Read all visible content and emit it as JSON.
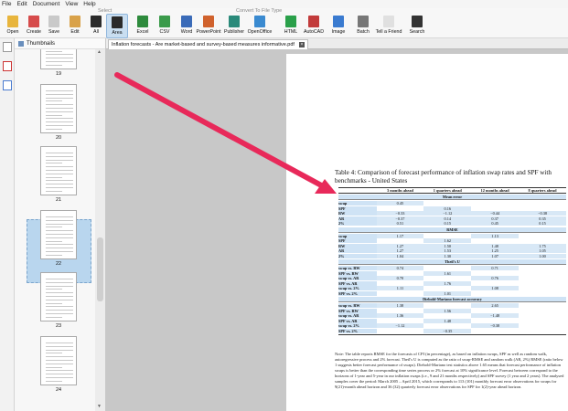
{
  "menu": [
    "File",
    "Edit",
    "Document",
    "View",
    "Help"
  ],
  "toolbar": {
    "select_group": "Select",
    "convert_group": "Convert To File Type",
    "tools": [
      {
        "label": "Open",
        "icon": "folder-icon",
        "color": "#e8b53d"
      },
      {
        "label": "Create",
        "icon": "create-pdf-icon",
        "color": "#d64b4b"
      },
      {
        "label": "Save",
        "icon": "save-icon",
        "color": "#c9c9c9"
      },
      {
        "label": "Edit",
        "icon": "edit-icon",
        "color": "#d9a24a"
      },
      {
        "label": "All",
        "icon": "select-all-icon",
        "color": "#2b2b2b"
      },
      {
        "label": "Area",
        "icon": "select-area-icon",
        "color": "#2b2b2b"
      },
      {
        "label": "Excel",
        "icon": "excel-icon",
        "color": "#2e8b3d"
      },
      {
        "label": "CSV",
        "icon": "csv-icon",
        "color": "#3b9b4b"
      },
      {
        "label": "Word",
        "icon": "word-icon",
        "color": "#3a6bb8"
      },
      {
        "label": "PowerPoint",
        "icon": "powerpoint-icon",
        "color": "#d0622d"
      },
      {
        "label": "Publisher",
        "icon": "publisher-icon",
        "color": "#2a8a7a"
      },
      {
        "label": "OpenOffice",
        "icon": "openoffice-icon",
        "color": "#3a8ad0"
      },
      {
        "label": "HTML",
        "icon": "html-icon",
        "color": "#2aa04a"
      },
      {
        "label": "AutoCAD",
        "icon": "autocad-icon",
        "color": "#c23b3b"
      },
      {
        "label": "Image",
        "icon": "image-icon",
        "color": "#3a7bd0"
      },
      {
        "label": "Batch",
        "icon": "batch-icon",
        "color": "#777777"
      },
      {
        "label": "Tell a Friend",
        "icon": "mail-icon",
        "color": "#e0e0e0"
      },
      {
        "label": "Search",
        "icon": "binoculars-icon",
        "color": "#333333"
      }
    ]
  },
  "thumbnails": {
    "title": "Thumbnails",
    "pages": [
      "19",
      "20",
      "21",
      "22",
      "23",
      "24"
    ],
    "selected": "22"
  },
  "document": {
    "tab_title": "Inflation forecasts - Are market-based and survey-based measures informative.pdf",
    "table_caption": "Table 4: Comparison of forecast performance of inflation swap rates and SPF with benchmarks - United States",
    "columns": [
      "",
      "3 months ahead",
      "1 quarters ahead",
      "12 months ahead",
      "8 quarters ahead"
    ],
    "sections": [
      {
        "title": "Mean error",
        "rows": [
          [
            "swap",
            "0.45",
            "",
            "",
            ""
          ],
          [
            "SPF",
            "",
            "0.16",
            "",
            ""
          ],
          [
            "RW",
            "−0.33",
            "−1.12",
            "−0.44",
            "−0.38"
          ],
          [
            "AR",
            "−0.37",
            "0.14",
            "0.37",
            "0.35"
          ],
          [
            "2%",
            "0.51",
            "0.15",
            "0.45",
            "0.15"
          ]
        ]
      },
      {
        "title": "RMSE",
        "rows": [
          [
            "swap",
            "1.17",
            "",
            "1.13",
            ""
          ],
          [
            "SPF",
            "",
            "1.62",
            "",
            ""
          ],
          [
            "RW",
            "1.27",
            "1.50",
            "1.48",
            "1.75"
          ],
          [
            "AR",
            "1.27",
            "1.53",
            "1.25",
            "1.05"
          ],
          [
            "2%",
            "1.04",
            "1.30",
            "1.07",
            "1.00"
          ]
        ]
      },
      {
        "title": "Theil's U",
        "rows": [
          [
            "swap vs. RW",
            "0.74",
            "",
            "0.71",
            ""
          ],
          [
            "SPF vs. RW",
            "",
            "1.61",
            "",
            ""
          ],
          [
            "swap vs. AR",
            "0.70",
            "",
            "0.76",
            ""
          ],
          [
            "SPF vs. AR",
            "",
            "1.76",
            "",
            ""
          ],
          [
            "swap vs. 2%",
            "1.11",
            "",
            "1.08",
            ""
          ],
          [
            "SPF vs. 2%",
            "",
            "1.01",
            "",
            ""
          ]
        ]
      },
      {
        "title": "Diebold-Mariano forecast accuracy",
        "rows": [
          [
            "swap vs. RW",
            "1.38",
            "",
            "2.65",
            ""
          ],
          [
            "SPF vs. RW",
            "",
            "1.56",
            "",
            ""
          ],
          [
            "swap vs. AR",
            "1.36",
            "",
            "−1.48",
            ""
          ],
          [
            "SPF vs. AR",
            "",
            "1.48",
            "",
            ""
          ],
          [
            "swap vs. 2%",
            "−1.12",
            "",
            "−0.38",
            ""
          ],
          [
            "SPF vs. 2%",
            "",
            "−0.35",
            "",
            ""
          ]
        ]
      }
    ],
    "note": "Note: The table reports RMSE for the forecasts of CPI (in percentage), as based on inflation swaps, SPF as well as random walk, autoregressive process and 2% forecast. Theil's U is computed as the ratio of swap-RMSE and random walk (AR, 2%) RMSE (ratio below 1 suggests better forecast performance of swaps). Diebold-Mariano test statistics above 1.65 means that forecast performance of inflation swaps is better than the corresponding time series process or 2% forecast at 10% significance level. Forecast between correspond to the horizons of 1-year and 5-year in our inflation swaps (i.e., 9 and 21 months respectively) and SPF survey (1 year and 2 years). The analysed samples cover the period: March 2005 – April 2015, which corresponds to 113 (101) monthly forecast error observations for swaps for 9(21)-month ahead horizon and 36 (32) quarterly forecast error observations for SPF for 1(2)-year ahead horizon."
  },
  "arrow_color": "#e8295a"
}
